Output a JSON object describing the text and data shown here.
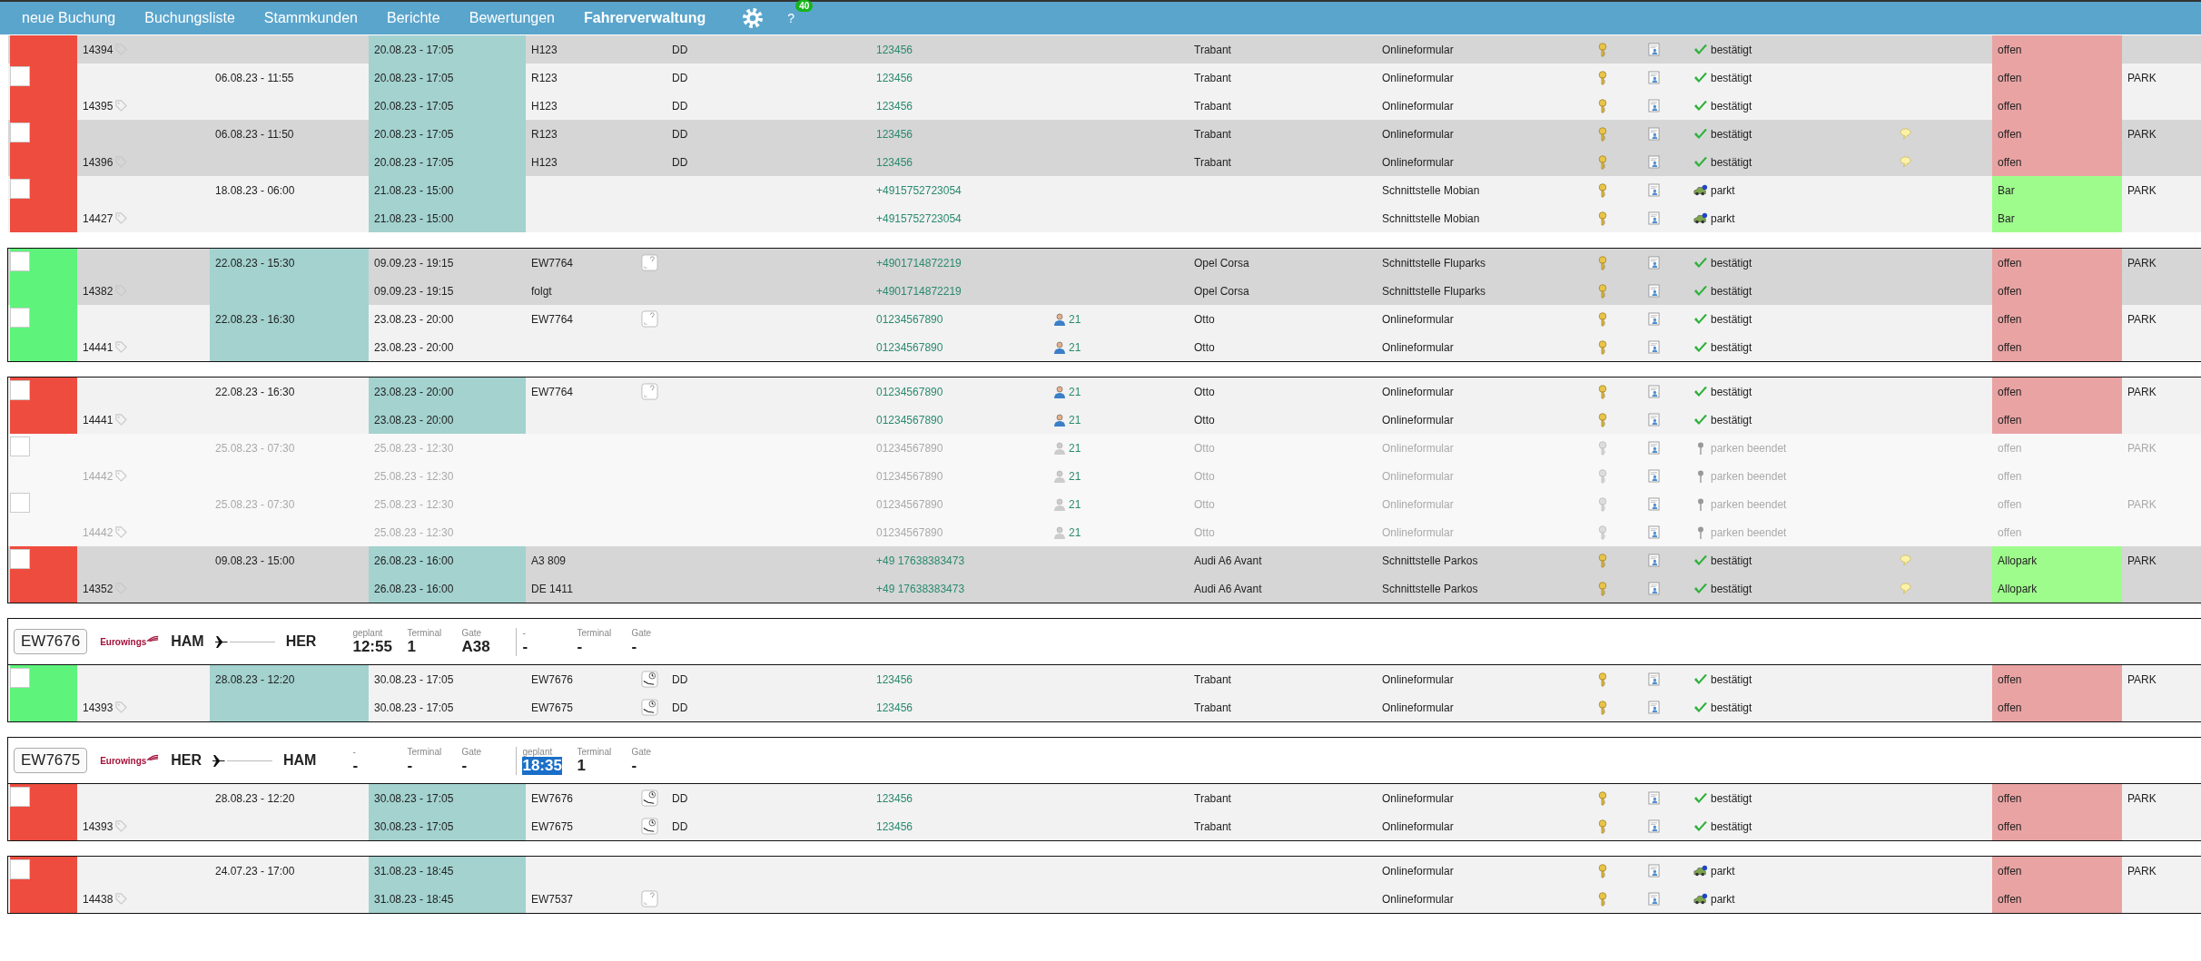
{
  "nav": {
    "items": [
      {
        "label": "neue Buchung",
        "selected": false
      },
      {
        "label": "Buchungsliste",
        "selected": false
      },
      {
        "label": "Stammkunden",
        "selected": false
      },
      {
        "label": "Berichte",
        "selected": false
      },
      {
        "label": "Bewertungen",
        "selected": false
      },
      {
        "label": "Fahrerverwaltung",
        "selected": true
      }
    ],
    "help": "?",
    "badge": "40"
  },
  "groups": [
    {
      "bookings": [
        {
          "id": "14394",
          "highlight": {
            "kind": "travel"
          },
          "color": "#ee4c3f",
          "shaded": true,
          "disabled": false,
          "payment_cell": {
            "color": "#e9a3a3"
          },
          "lines": [
            {
              "travel": "20.08.23 - 17:05",
              "flight": "H123",
              "airport": "DD",
              "phone": "123456",
              "car": "Trabant",
              "source": "Onlineformular",
              "status": {
                "kind": "confirmed",
                "label": "bestätigt"
              },
              "payment": "offen"
            }
          ]
        },
        {
          "id": "14395",
          "checked": false,
          "highlight": {
            "kind": "travel"
          },
          "color": "#ee4c3f",
          "shaded": false,
          "disabled": false,
          "payment_cell": {
            "color": "#e9a3a3"
          },
          "lines": [
            {
              "created": "06.08.23 - 11:55",
              "travel": "20.08.23 - 17:05",
              "flight": "R123",
              "airport": "DD",
              "phone": "123456",
              "car": "Trabant",
              "source": "Onlineformular",
              "status": {
                "kind": "confirmed",
                "label": "bestätigt"
              },
              "payment": "offen",
              "park": "PARK"
            },
            {
              "travel": "20.08.23 - 17:05",
              "flight": "H123",
              "airport": "DD",
              "phone": "123456",
              "car": "Trabant",
              "source": "Onlineformular",
              "status": {
                "kind": "confirmed",
                "label": "bestätigt"
              },
              "payment": "offen"
            }
          ]
        },
        {
          "id": "14396",
          "checked": false,
          "highlight": {
            "kind": "travel"
          },
          "color": "#ee4c3f",
          "shaded": true,
          "disabled": false,
          "payment_cell": {
            "color": "#e9a3a3"
          },
          "lines": [
            {
              "created": "06.08.23 - 11:50",
              "travel": "20.08.23 - 17:05",
              "flight": "R123",
              "airport": "DD",
              "phone": "123456",
              "car": "Trabant",
              "source": "Onlineformular",
              "status": {
                "kind": "confirmed",
                "label": "bestätigt"
              },
              "comment_icon": {
                "kind": "note"
              },
              "payment": "offen",
              "park": "PARK"
            },
            {
              "travel": "20.08.23 - 17:05",
              "flight": "H123",
              "airport": "DD",
              "phone": "123456",
              "car": "Trabant",
              "source": "Onlineformular",
              "status": {
                "kind": "confirmed",
                "label": "bestätigt"
              },
              "comment_icon": {
                "kind": "note"
              },
              "payment": "offen"
            }
          ]
        },
        {
          "id": "14427",
          "checked": false,
          "highlight": {
            "kind": "travel"
          },
          "color": "#ee4c3f",
          "shaded": false,
          "disabled": false,
          "payment_cell": {
            "color": "#9efc8c"
          },
          "lines": [
            {
              "created": "18.08.23 - 06:00",
              "travel": "21.08.23 - 15:00",
              "phone": "+4915752723054",
              "source": "Schnittstelle Mobian",
              "status": {
                "kind": "parked",
                "label": "parkt"
              },
              "payment": "Bar",
              "park": "PARK"
            },
            {
              "travel": "21.08.23 - 15:00",
              "phone": "+4915752723054",
              "source": "Schnittstelle Mobian",
              "status": {
                "kind": "parked",
                "label": "parkt"
              },
              "payment": "Bar"
            }
          ]
        }
      ]
    },
    {
      "frame": {
        "kind": "box"
      },
      "bookings": [
        {
          "id": "14382",
          "checked": false,
          "highlight": {
            "kind": "created"
          },
          "color": "#5ef37b",
          "shaded": true,
          "disabled": false,
          "payment_cell": {
            "color": "#e9a3a3"
          },
          "lines": [
            {
              "created": "22.08.23 - 15:30",
              "travel": "09.09.23 - 19:15",
              "flight": "EW7764",
              "flight_icon": {
                "kind": "unknown"
              },
              "phone": "+4901714872219",
              "car": "Opel Corsa",
              "source": "Schnittstelle Fluparks",
              "status": {
                "kind": "confirmed",
                "label": "bestätigt"
              },
              "payment": "offen",
              "park": "PARK"
            },
            {
              "travel": "09.09.23 - 19:15",
              "flight": "folgt",
              "phone": "+4901714872219",
              "car": "Opel Corsa",
              "source": "Schnittstelle Fluparks",
              "status": {
                "kind": "confirmed",
                "label": "bestätigt"
              },
              "payment": "offen"
            }
          ]
        },
        {
          "id": "14441",
          "checked": false,
          "highlight": {
            "kind": "created"
          },
          "color": "#5ef37b",
          "shaded": false,
          "disabled": false,
          "payment_cell": {
            "color": "#e9a3a3"
          },
          "lines": [
            {
              "created": "22.08.23 - 16:30",
              "travel": "23.08.23 - 20:00",
              "flight": "EW7764",
              "flight_icon": {
                "kind": "unknown"
              },
              "phone": "01234567890",
              "driver": "21",
              "car": "Otto",
              "source": "Onlineformular",
              "status": {
                "kind": "confirmed",
                "label": "bestätigt"
              },
              "payment": "offen",
              "park": "PARK"
            },
            {
              "travel": "23.08.23 - 20:00",
              "phone": "01234567890",
              "driver": "21",
              "car": "Otto",
              "source": "Onlineformular",
              "status": {
                "kind": "confirmed",
                "label": "bestätigt"
              },
              "payment": "offen"
            }
          ]
        }
      ]
    },
    {
      "frame": {
        "kind": "box"
      },
      "bookings": [
        {
          "id": "14441",
          "checked": false,
          "highlight": {
            "kind": "travel"
          },
          "color": "#ee4c3f",
          "shaded": false,
          "disabled": false,
          "payment_cell": {
            "color": "#e9a3a3"
          },
          "lines": [
            {
              "created": "22.08.23 - 16:30",
              "travel": "23.08.23 - 20:00",
              "flight": "EW7764",
              "flight_icon": {
                "kind": "unknown"
              },
              "phone": "01234567890",
              "driver": "21",
              "car": "Otto",
              "source": "Onlineformular",
              "status": {
                "kind": "confirmed",
                "label": "bestätigt"
              },
              "payment": "offen",
              "park": "PARK"
            },
            {
              "travel": "23.08.23 - 20:00",
              "phone": "01234567890",
              "driver": "21",
              "car": "Otto",
              "source": "Onlineformular",
              "status": {
                "kind": "confirmed",
                "label": "bestätigt"
              },
              "payment": "offen"
            }
          ]
        },
        {
          "id": "14442",
          "checked": false,
          "shaded": false,
          "disabled": true,
          "lines": [
            {
              "created": "25.08.23 - 07:30",
              "travel": "25.08.23 - 12:30",
              "phone": "01234567890",
              "driver": "21",
              "car": "Otto",
              "source": "Onlineformular",
              "status": {
                "kind": "ended",
                "label": "parken beendet"
              },
              "payment": "offen",
              "park": "PARK"
            },
            {
              "travel": "25.08.23 - 12:30",
              "phone": "01234567890",
              "driver": "21",
              "car": "Otto",
              "source": "Onlineformular",
              "status": {
                "kind": "ended",
                "label": "parken beendet"
              },
              "payment": "offen"
            }
          ]
        },
        {
          "id": "14442",
          "checked": false,
          "shaded": false,
          "disabled": true,
          "lines": [
            {
              "created": "25.08.23 - 07:30",
              "travel": "25.08.23 - 12:30",
              "phone": "01234567890",
              "driver": "21",
              "car": "Otto",
              "source": "Onlineformular",
              "status": {
                "kind": "ended",
                "label": "parken beendet"
              },
              "payment": "offen",
              "park": "PARK"
            },
            {
              "travel": "25.08.23 - 12:30",
              "phone": "01234567890",
              "driver": "21",
              "car": "Otto",
              "source": "Onlineformular",
              "status": {
                "kind": "ended",
                "label": "parken beendet"
              },
              "payment": "offen"
            }
          ]
        },
        {
          "id": "14352",
          "checked": false,
          "highlight": {
            "kind": "travel"
          },
          "color": "#ee4c3f",
          "shaded": true,
          "disabled": false,
          "payment_cell": {
            "color": "#9efc8c"
          },
          "lines": [
            {
              "created": "09.08.23 - 15:00",
              "travel": "26.08.23 - 16:00",
              "flight": "A3 809",
              "phone": "+49 17638383473",
              "car": "Audi A6 Avant",
              "source": "Schnittstelle Parkos",
              "status": {
                "kind": "confirmed",
                "label": "bestätigt"
              },
              "comment_icon": {
                "kind": "note"
              },
              "payment": "Allopark",
              "park": "PARK"
            },
            {
              "travel": "26.08.23 - 16:00",
              "flight": "DE 1411",
              "phone": "+49 17638383473",
              "car": "Audi A6 Avant",
              "source": "Schnittstelle Parkos",
              "status": {
                "kind": "confirmed",
                "label": "bestätigt"
              },
              "comment_icon": {
                "kind": "note"
              },
              "payment": "Allopark"
            }
          ]
        }
      ]
    },
    {
      "frame": {
        "kind": "box"
      },
      "flight": {
        "number": "EW7676",
        "airline": "Eurowings",
        "from": "HAM",
        "to": "HER",
        "legs": [
          {
            "fields": [
              {
                "label": "geplant",
                "value": "12:55",
                "highlighted": false
              },
              {
                "label": "Terminal",
                "value": "1",
                "highlighted": false
              },
              {
                "label": "Gate",
                "value": "A38",
                "highlighted": false
              }
            ]
          },
          {
            "fields": [
              {
                "label": "-",
                "value": "-",
                "highlighted": false
              },
              {
                "label": "Terminal",
                "value": "-",
                "highlighted": false
              },
              {
                "label": "Gate",
                "value": "-",
                "highlighted": false
              }
            ]
          }
        ]
      },
      "bookings": [
        {
          "id": "14393",
          "checked": false,
          "highlight": {
            "kind": "created"
          },
          "color": "#5ef37b",
          "shaded": false,
          "disabled": false,
          "payment_cell": {
            "color": "#e9a3a3"
          },
          "lines": [
            {
              "created": "28.08.23 - 12:20",
              "travel": "30.08.23 - 17:05",
              "flight": "EW7676",
              "flight_icon": {
                "kind": "clock"
              },
              "airport": "DD",
              "phone": "123456",
              "car": "Trabant",
              "source": "Onlineformular",
              "status": {
                "kind": "confirmed",
                "label": "bestätigt"
              },
              "payment": "offen",
              "park": "PARK"
            },
            {
              "travel": "30.08.23 - 17:05",
              "flight": "EW7675",
              "flight_icon": {
                "kind": "clock"
              },
              "airport": "DD",
              "phone": "123456",
              "car": "Trabant",
              "source": "Onlineformular",
              "status": {
                "kind": "confirmed",
                "label": "bestätigt"
              },
              "payment": "offen"
            }
          ]
        }
      ]
    },
    {
      "frame": {
        "kind": "box"
      },
      "flight": {
        "number": "EW7675",
        "airline": "Eurowings",
        "from": "HER",
        "to": "HAM",
        "legs": [
          {
            "fields": [
              {
                "label": "-",
                "value": "-",
                "highlighted": false
              },
              {
                "label": "Terminal",
                "value": "-",
                "highlighted": false
              },
              {
                "label": "Gate",
                "value": "-",
                "highlighted": false
              }
            ]
          },
          {
            "fields": [
              {
                "label": "geplant",
                "value": "18:35",
                "highlighted": true
              },
              {
                "label": "Terminal",
                "value": "1",
                "highlighted": false
              },
              {
                "label": "Gate",
                "value": "-",
                "highlighted": false
              }
            ]
          }
        ]
      },
      "bookings": [
        {
          "id": "14393",
          "checked": false,
          "highlight": {
            "kind": "travel"
          },
          "color": "#ee4c3f",
          "shaded": false,
          "disabled": false,
          "payment_cell": {
            "color": "#e9a3a3"
          },
          "lines": [
            {
              "created": "28.08.23 - 12:20",
              "travel": "30.08.23 - 17:05",
              "flight": "EW7676",
              "flight_icon": {
                "kind": "clock"
              },
              "airport": "DD",
              "phone": "123456",
              "car": "Trabant",
              "source": "Onlineformular",
              "status": {
                "kind": "confirmed",
                "label": "bestätigt"
              },
              "payment": "offen",
              "park": "PARK"
            },
            {
              "travel": "30.08.23 - 17:05",
              "flight": "EW7675",
              "flight_icon": {
                "kind": "clock"
              },
              "airport": "DD",
              "phone": "123456",
              "car": "Trabant",
              "source": "Onlineformular",
              "status": {
                "kind": "confirmed",
                "label": "bestätigt"
              },
              "payment": "offen"
            }
          ]
        }
      ]
    },
    {
      "frame": {
        "kind": "box"
      },
      "bookings": [
        {
          "id": "14438",
          "checked": false,
          "highlight": {
            "kind": "travel"
          },
          "color": "#ee4c3f",
          "shaded": false,
          "disabled": false,
          "payment_cell": {
            "color": "#e9a3a3"
          },
          "lines": [
            {
              "created": "24.07.23 - 17:00",
              "travel": "31.08.23 - 18:45",
              "source": "Onlineformular",
              "status": {
                "kind": "parked",
                "label": "parkt"
              },
              "payment": "offen",
              "park": "PARK"
            },
            {
              "travel": "31.08.23 - 18:45",
              "flight": "EW7537",
              "flight_icon": {
                "kind": "unknown"
              },
              "source": "Onlineformular",
              "status": {
                "kind": "parked",
                "label": "parkt"
              },
              "payment": "offen"
            }
          ]
        }
      ]
    }
  ]
}
